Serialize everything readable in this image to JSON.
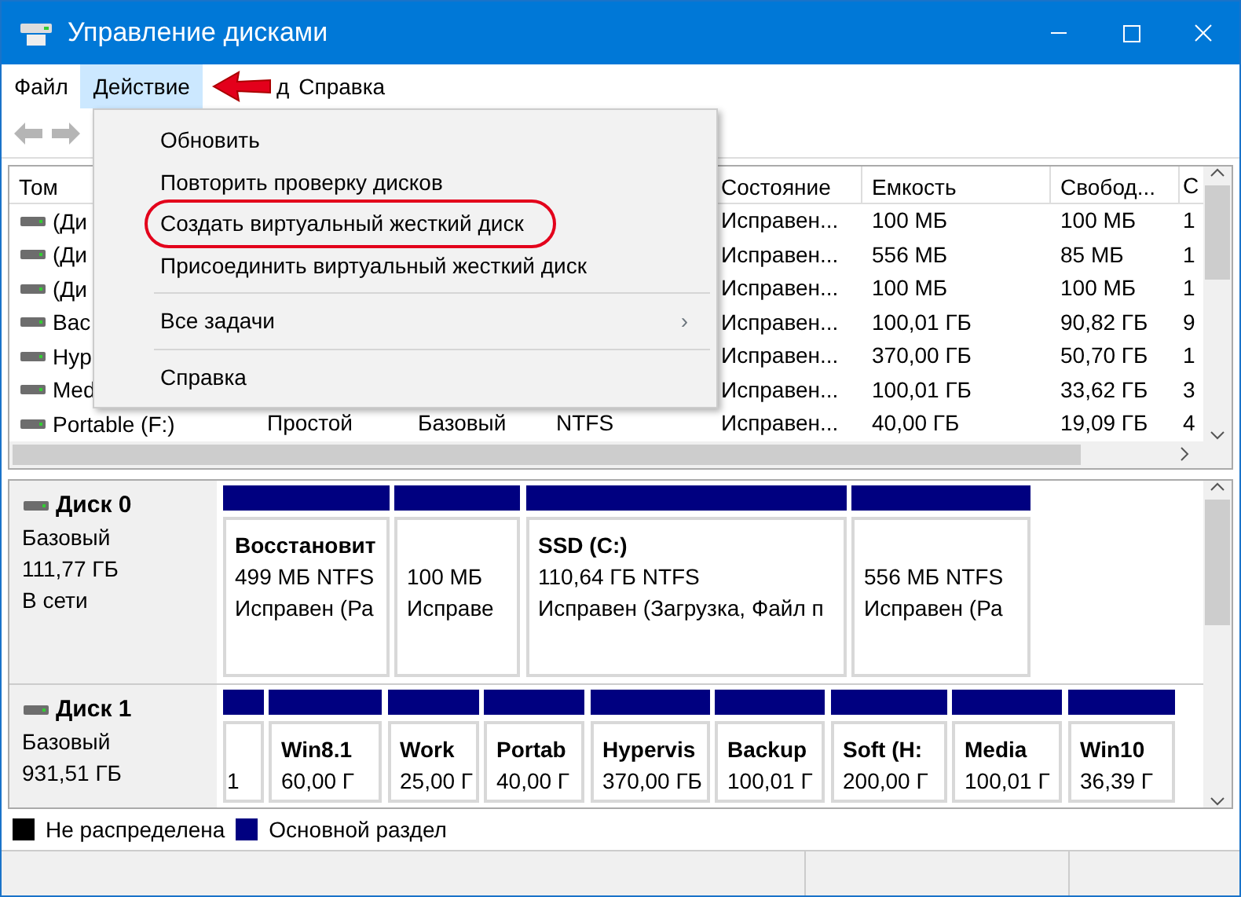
{
  "window": {
    "title": "Управление дисками"
  },
  "menu_bar": [
    {
      "label": "Файл",
      "selected": false
    },
    {
      "label": "Действие",
      "selected": true
    },
    {
      "label": "д",
      "selected": false
    },
    {
      "label": "Справка",
      "selected": false
    }
  ],
  "action_menu": [
    {
      "kind": "item",
      "label": "Обновить",
      "highlighted": false
    },
    {
      "kind": "item",
      "label": "Повторить проверку дисков",
      "highlighted": false
    },
    {
      "kind": "item",
      "label": "Создать виртуальный жесткий диск",
      "highlighted": true
    },
    {
      "kind": "item",
      "label": "Присоединить виртуальный жесткий диск",
      "highlighted": false
    },
    {
      "kind": "separator"
    },
    {
      "kind": "submenu",
      "label": "Все задачи",
      "arrow": "›",
      "highlighted": false
    },
    {
      "kind": "separator"
    },
    {
      "kind": "item",
      "label": "Справка",
      "highlighted": false
    }
  ],
  "volume_table": {
    "columns": [
      "Том",
      null,
      null,
      null,
      "Состояние",
      "Емкость",
      "Свобод...",
      "С"
    ],
    "rows": [
      [
        "(Ди",
        null,
        null,
        null,
        "Исправен...",
        "100 МБ",
        "100 МБ",
        "1"
      ],
      [
        "(Ди",
        null,
        null,
        null,
        "Исправен...",
        "556 МБ",
        "85 МБ",
        "1"
      ],
      [
        "(Ди",
        null,
        null,
        null,
        "Исправен...",
        "100 МБ",
        "100 МБ",
        "1"
      ],
      [
        "Bac",
        null,
        null,
        null,
        "Исправен...",
        "100,01 ГБ",
        "90,82 ГБ",
        "9"
      ],
      [
        "Hyp",
        null,
        null,
        null,
        "Исправен...",
        "370,00 ГБ",
        "50,70 ГБ",
        "1"
      ],
      [
        "Med",
        null,
        null,
        null,
        "Исправен...",
        "100,01 ГБ",
        "33,62 ГБ",
        "3"
      ],
      [
        "Portable (F:)",
        "Простой",
        "Базовый",
        "NTFS",
        "Исправен...",
        "40,00 ГБ",
        "19,09 ГБ",
        "4"
      ]
    ]
  },
  "disks": [
    {
      "name": "Диск 0",
      "lines": [
        "Базовый",
        "111,77 ГБ",
        "В сети"
      ],
      "partitions": [
        {
          "color": "#000080",
          "lines": [
            "Восстановит",
            "499 МБ NTFS",
            "Исправен (Ра"
          ]
        },
        {
          "color": "#000080",
          "lines": [
            "100 МБ",
            "Исправе"
          ]
        },
        {
          "color": "#000080",
          "lines": [
            "SSD  (C:)",
            "110,64 ГБ NTFS",
            "Исправен (Загрузка, Файл п"
          ]
        },
        {
          "color": "#000080",
          "lines": [
            "556 МБ NTFS",
            "Исправен (Ра"
          ]
        }
      ]
    },
    {
      "name": "Диск 1",
      "lines": [
        "Базовый",
        "931,51 ГБ"
      ],
      "partitions": [
        {
          "color": "#000080",
          "lines": [
            "1"
          ]
        },
        {
          "color": "#000080",
          "lines": [
            "Win8.1",
            "60,00 Г"
          ]
        },
        {
          "color": "#000080",
          "lines": [
            "Work",
            "25,00 Г"
          ]
        },
        {
          "color": "#000080",
          "lines": [
            "Portab",
            "40,00 Г"
          ]
        },
        {
          "color": "#000080",
          "lines": [
            "Hypervis",
            "370,00 ГБ"
          ]
        },
        {
          "color": "#000080",
          "lines": [
            "Backup",
            "100,01 Г"
          ]
        },
        {
          "color": "#000080",
          "lines": [
            "Soft  (H:",
            "200,00 Г"
          ]
        },
        {
          "color": "#000080",
          "lines": [
            "Media",
            "100,01 Г"
          ]
        },
        {
          "color": "#000080",
          "lines": [
            "Win10",
            "36,39 Г"
          ]
        }
      ]
    }
  ],
  "legend": [
    {
      "label": "Не распределена",
      "color": "#000000"
    },
    {
      "label": "Основной раздел",
      "color": "#000080"
    }
  ]
}
